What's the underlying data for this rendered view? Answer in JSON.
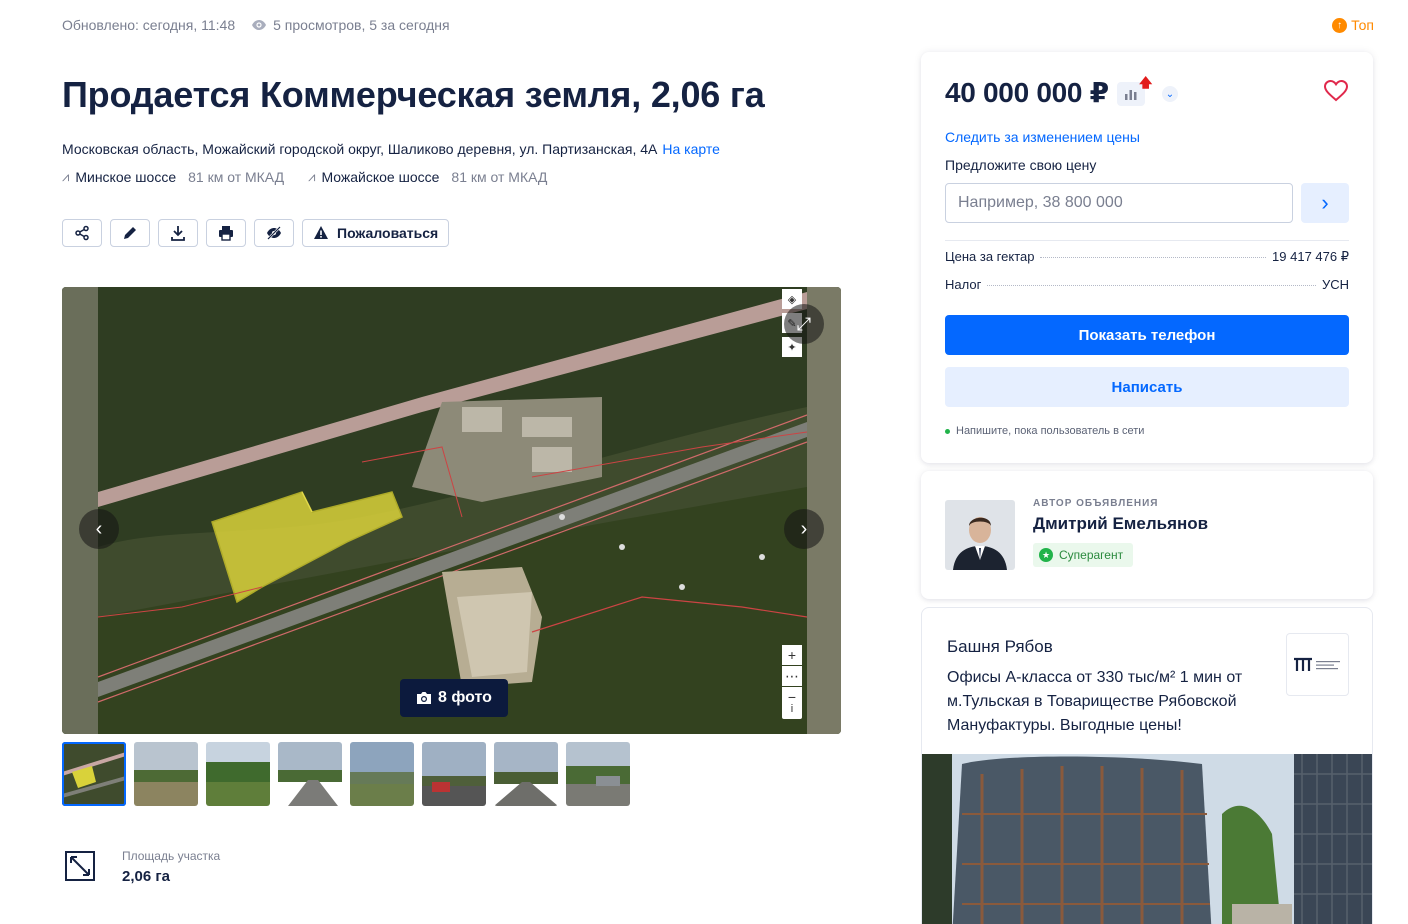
{
  "meta": {
    "updated": "Обновлено: сегодня, 11:48",
    "views": "5 просмотров, 5 за сегодня",
    "top_label": "Топ"
  },
  "listing": {
    "title": "Продается Коммерческая земля, 2,06 га",
    "address": "Московская область, Можайский городской округ, Шаликово деревня, ул. Партизанская, 4А",
    "map_link": "На карте",
    "highways": [
      {
        "name": "Минское шоссе",
        "distance": "81 км от МКАД"
      },
      {
        "name": "Можайское шоссе",
        "distance": "81 км от МКАД"
      }
    ]
  },
  "actions": {
    "complain_label": "Пожаловаться"
  },
  "gallery": {
    "photo_count": "8 фото"
  },
  "area": {
    "label": "Площадь участка",
    "value": "2,06 га"
  },
  "price_card": {
    "price": "40 000 000 ₽",
    "follow_label": "Следить за изменением цены",
    "offer_label": "Предложите свою цену",
    "offer_placeholder": "Например, 38 800 000",
    "rows": [
      {
        "label": "Цена за гектар",
        "value": "19 417 476 ₽"
      },
      {
        "label": "Налог",
        "value": "УСН"
      }
    ],
    "show_phone_label": "Показать телефон",
    "write_label": "Написать",
    "online_label": "Напишите, пока пользователь в сети"
  },
  "author": {
    "label": "АВТОР ОБЪЯВЛЕНИЯ",
    "name": "Дмитрий Емельянов",
    "badge": "Суперагент"
  },
  "ad": {
    "title": "Башня Рябов",
    "text": "Офисы А-класса от 330 тыс/м² 1 мин от м.Тульская в Товариществе Рябовской Мануфактуры. Выгодные цены!"
  },
  "colors": {
    "accent": "#0468ff",
    "text": "#152242",
    "muted": "#7a7f90",
    "top": "#ff8a00",
    "online": "#21b34a"
  }
}
